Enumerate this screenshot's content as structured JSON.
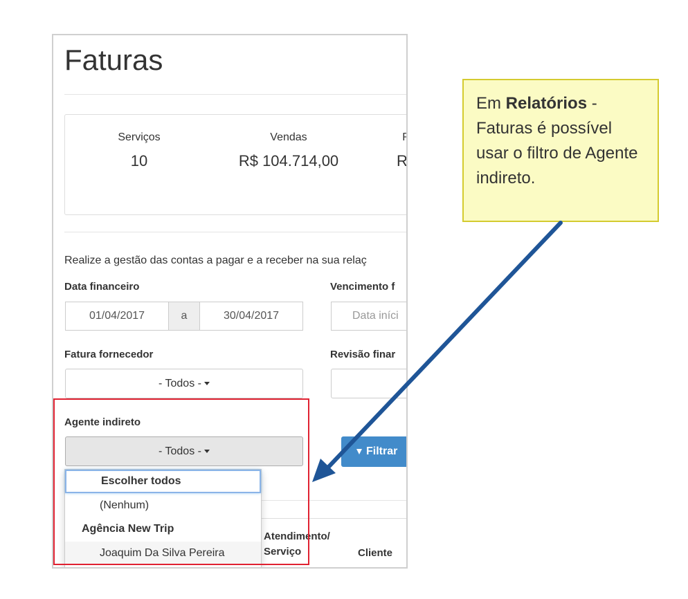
{
  "page": {
    "title": "Faturas",
    "stats": [
      {
        "label": "Serviços",
        "value": "10"
      },
      {
        "label": "Vendas",
        "value": "R$ 104.714,00"
      },
      {
        "label": "R",
        "value": "R$"
      }
    ],
    "description": "Realize a gestão das contas a pagar e a receber na sua relaç"
  },
  "filters": {
    "data_financeiro": {
      "label": "Data financeiro",
      "start": "01/04/2017",
      "separator": "a",
      "end": "30/04/2017"
    },
    "vencimento": {
      "label": "Vencimento f",
      "placeholder": "Data iníci"
    },
    "fatura_fornecedor": {
      "label": "Fatura fornecedor",
      "value": "- Todos -"
    },
    "revisao": {
      "label": "Revisão finar"
    },
    "agente_indireto": {
      "label": "Agente indireto",
      "value": "- Todos -"
    },
    "filter_button": "Filtrar"
  },
  "dropdown": {
    "select_all": "Escolher todos",
    "none": "(Nenhum)",
    "group": "Agência New Trip",
    "option": "Joaquim Da Silva Pereira"
  },
  "table": {
    "col_atendimento_1": "Atendimento/",
    "col_atendimento_2": "Serviço",
    "col_cliente": "Cliente"
  },
  "callout": {
    "part1": "Em ",
    "bold": "Relatórios",
    "part2": " - Faturas é possível usar o filtro de Agente indireto."
  },
  "colors": {
    "highlight": "#e02131",
    "arrow": "#1f5597",
    "callout_bg": "#fbfbc4",
    "button": "#428bca"
  }
}
